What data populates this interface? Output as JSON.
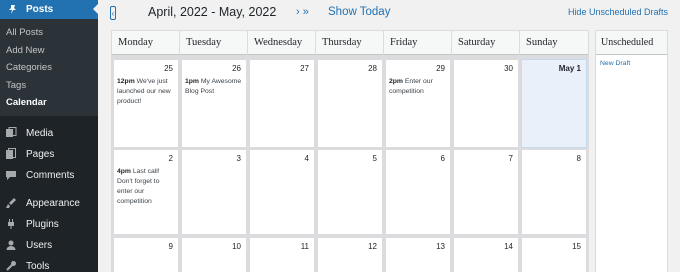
{
  "sidebar": {
    "posts": {
      "label": "Posts",
      "icon": "pushpin-icon"
    },
    "posts_submenu": [
      {
        "label": "All Posts"
      },
      {
        "label": "Add New"
      },
      {
        "label": "Categories"
      },
      {
        "label": "Tags"
      },
      {
        "label": "Calendar",
        "current": true
      }
    ],
    "items": [
      {
        "label": "Media",
        "icon": "media-icon"
      },
      {
        "label": "Pages",
        "icon": "pages-icon"
      },
      {
        "label": "Comments",
        "icon": "comments-icon"
      },
      {
        "label": "Appearance",
        "icon": "appearance-icon"
      },
      {
        "label": "Plugins",
        "icon": "plugins-icon"
      },
      {
        "label": "Users",
        "icon": "users-icon"
      },
      {
        "label": "Tools",
        "icon": "tools-icon"
      }
    ]
  },
  "toolbar": {
    "prev_glyph": "‹",
    "range": "April, 2022 - May, 2022",
    "next_glyphs": "› »",
    "show_today": "Show Today",
    "hide_unscheduled": "Hide Unscheduled Drafts"
  },
  "calendar": {
    "weekdays": [
      "Monday",
      "Tuesday",
      "Wednesday",
      "Thursday",
      "Friday",
      "Saturday",
      "Sunday"
    ],
    "weeks": [
      [
        {
          "day": "25",
          "time": "12pm",
          "title": "We've just launched our new product!"
        },
        {
          "day": "26",
          "time": "1pm",
          "title": "My Awesome Blog Post"
        },
        {
          "day": "27"
        },
        {
          "day": "28"
        },
        {
          "day": "29",
          "time": "2pm",
          "title": "Enter our competition"
        },
        {
          "day": "30"
        },
        {
          "day": "May 1",
          "today": true
        }
      ],
      [
        {
          "day": "2",
          "time": "4pm",
          "title": "Last call! Don't forget to enter our competition"
        },
        {
          "day": "3"
        },
        {
          "day": "4"
        },
        {
          "day": "5"
        },
        {
          "day": "6"
        },
        {
          "day": "7"
        },
        {
          "day": "8"
        }
      ],
      [
        {
          "day": "9"
        },
        {
          "day": "10"
        },
        {
          "day": "11"
        },
        {
          "day": "12"
        },
        {
          "day": "13"
        },
        {
          "day": "14"
        },
        {
          "day": "15"
        }
      ]
    ]
  },
  "unscheduled": {
    "heading": "Unscheduled",
    "drafts": [
      "New Draft"
    ]
  },
  "colors": {
    "sidebar_bg": "#1d2327",
    "accent": "#2271b1",
    "today_bg": "#e9f0fa"
  }
}
